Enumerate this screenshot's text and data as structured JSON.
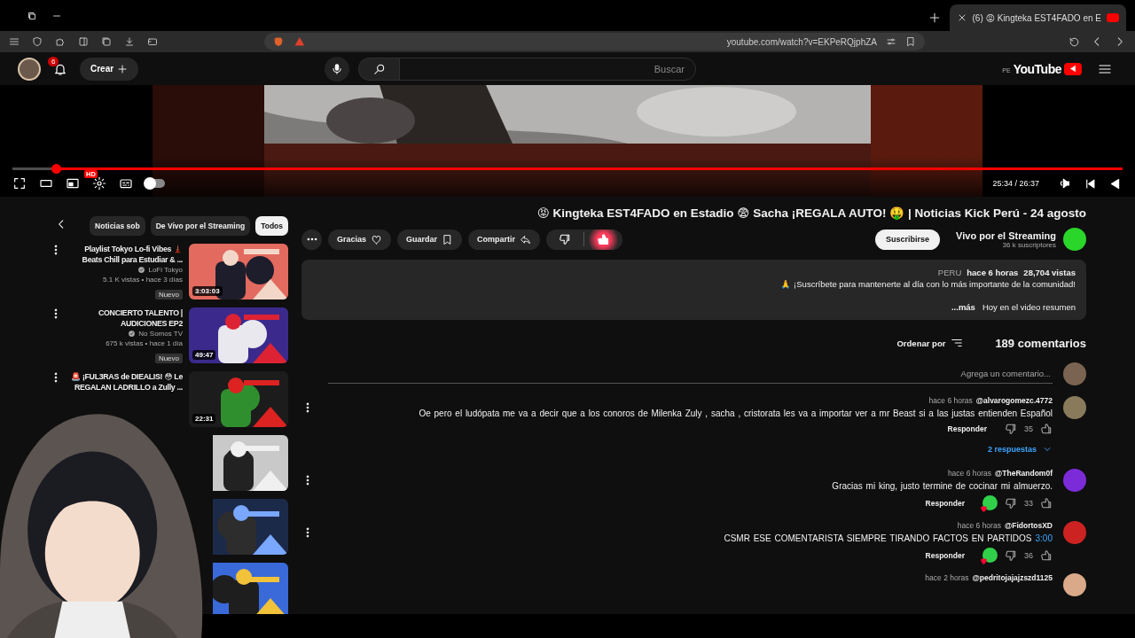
{
  "browser": {
    "tab": {
      "title": "(6) 😡 Kingteka EST4FADO en E",
      "selected": true
    },
    "url": "youtube.com/watch?v=EKPeRQjphZA"
  },
  "header": {
    "logo": "YouTube",
    "region": "PE",
    "search_placeholder": "Buscar",
    "create": "Crear",
    "notifications": "6"
  },
  "player": {
    "level": 0.96,
    "time": "25:34 / 26:37",
    "quality": "HD",
    "autoplay": false
  },
  "video": {
    "title": "😡 Kingteka EST4FADO en Estadio 😨 Sacha ¡REGALA AUTO! 🤑 | Noticias Kick Perú - 24 agosto",
    "channel": {
      "name": "Vivo por el Streaming",
      "subscribers": "36 k suscriptores",
      "subscribe": "Suscribirse"
    },
    "liked": true,
    "actions": [
      {
        "kind": "thanks",
        "label": "Gracias"
      },
      {
        "kind": "save",
        "label": "Guardar"
      },
      {
        "kind": "share",
        "label": "Compartir"
      }
    ],
    "description": {
      "views": "28,704 vistas",
      "age": "hace 6 horas",
      "tag": "PERU",
      "lines": [
        "🙏 ¡Suscríbete para mantenerte al día con lo más importante de la comunidad!",
        "Hoy en el video resumen"
      ],
      "more": "...más"
    }
  },
  "comments": {
    "count": "189 comentarios",
    "sort": "Ordenar por",
    "placeholder": "Agrega un comentario...",
    "items": [
      {
        "author": "@alvarogomezc.4772",
        "time": "hace 6 horas",
        "text": "Oe pero el ludópata me va a decir que a los conoros de Milenka  Zuly , sacha , cristorata les va a importar ver a mr Beast si a las justas entienden Español",
        "likes": "35",
        "hearted": false,
        "reply": "Responder",
        "replies": "2 respuestas"
      },
      {
        "author": "@TheRandom0f",
        "time": "hace 6 horas",
        "text": "Gracias mi king, justo termine de cocinar mi almuerzo.",
        "likes": "33",
        "hearted": true,
        "reply": "Responder"
      },
      {
        "author": "@FidortosXD",
        "time": "hace 6 horas",
        "timestamp": "3:00",
        "text": "CSMR ESE COMENTARISTA  SIEMPRE TIRANDO FACTOS EN PARTIDOS",
        "likes": "36",
        "hearted": true,
        "reply": "Responder"
      },
      {
        "author": "@pedritojajajzszd1125",
        "time": "hace 2 horas"
      }
    ]
  },
  "sidebar": {
    "chips": [
      {
        "label": "Noticias sob",
        "selected": false
      },
      {
        "label": "De Vivo por el Streaming",
        "selected": false
      },
      {
        "label": "Todos",
        "selected": true
      }
    ],
    "videos": [
      {
        "kind": "full",
        "title": "Playlist Tokyo Lo-fi Vibes 🗼 Beats Chill para Estudiar & ...",
        "channel": "LoFi Tokyo",
        "meta": "5.1 K vistas • hace 3 días",
        "badge": "Nuevo",
        "duration": "3:03:03"
      },
      {
        "kind": "full",
        "title": "CONCIERTO TALENTO | AUDICIONES EP2",
        "channel": "No Somos TV",
        "meta": "675 k vistas • hace 1 día",
        "badge": "Nuevo",
        "duration": "49:47"
      },
      {
        "kind": "full",
        "title": "🚨 ¡FUL3RAS de DIEALIS! 😳 Le REGALAN LADRILLO a Zully ...",
        "duration": "22:31"
      },
      {
        "kind": "picture"
      },
      {
        "kind": "picture"
      },
      {
        "kind": "picture"
      }
    ]
  }
}
